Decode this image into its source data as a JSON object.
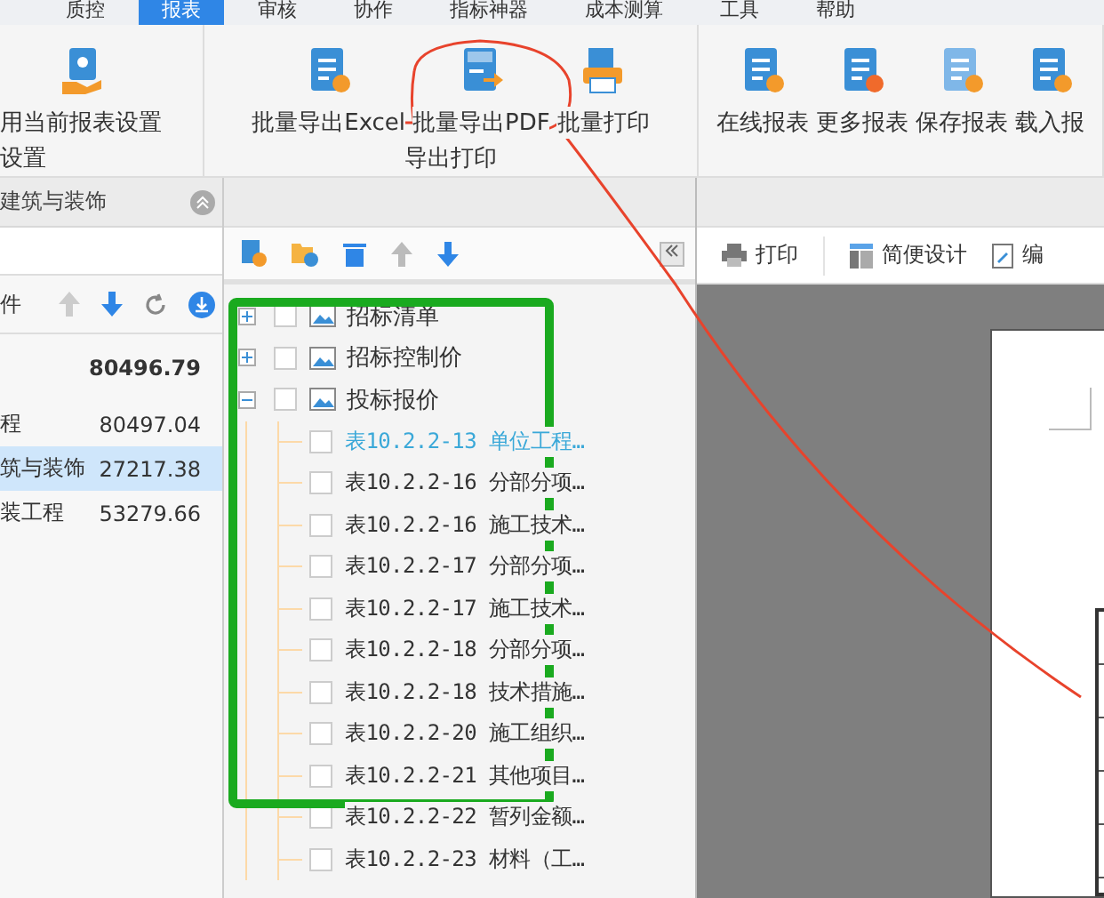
{
  "menu": [
    {
      "label": "质控",
      "selected": false
    },
    {
      "label": "报表",
      "selected": true
    },
    {
      "label": "审核",
      "selected": false
    },
    {
      "label": "协作",
      "selected": false
    },
    {
      "label": "指标神器",
      "selected": false
    },
    {
      "label": "成本测算",
      "selected": false
    },
    {
      "label": "工具",
      "selected": false
    },
    {
      "label": "帮助",
      "selected": false
    }
  ],
  "ribbon": {
    "groups": [
      {
        "label": "设置",
        "buttons": [
          {
            "label": "用当前报表设置"
          }
        ]
      },
      {
        "label": "导出打印",
        "buttons": [
          {
            "label": "批量导出Excel"
          },
          {
            "label": "批量导出PDF"
          },
          {
            "label": "批量打印"
          }
        ]
      },
      {
        "buttons": [
          {
            "label": "在线报表"
          },
          {
            "label": "更多报表"
          },
          {
            "label": "保存报表"
          },
          {
            "label": "载入报"
          }
        ]
      }
    ]
  },
  "project_panel": {
    "title": "建筑与装饰",
    "header_label": "件",
    "rows": [
      {
        "kind": "total",
        "value": "80496.79",
        "selected": false
      },
      {
        "kind": "item",
        "label": "程",
        "value": "80497.04",
        "selected": false
      },
      {
        "kind": "item",
        "label": "筑与装饰",
        "value": "27217.38",
        "selected": true
      },
      {
        "kind": "item",
        "label": "装工程",
        "value": "53279.66",
        "selected": false
      }
    ]
  },
  "report_tree": [
    {
      "label": "招标清单",
      "expanded": false,
      "checked": false
    },
    {
      "label": "招标控制价",
      "expanded": false,
      "checked": false
    },
    {
      "label": "投标报价",
      "expanded": true,
      "checked": false,
      "children": [
        {
          "label": "表10.2.2-13 单位工程…",
          "selected": true,
          "checked": false
        },
        {
          "label": "表10.2.2-16 分部分项…",
          "selected": false,
          "checked": false
        },
        {
          "label": "表10.2.2-16 施工技术…",
          "selected": false,
          "checked": false
        },
        {
          "label": "表10.2.2-17 分部分项…",
          "selected": false,
          "checked": false
        },
        {
          "label": "表10.2.2-17 施工技术…",
          "selected": false,
          "checked": false
        },
        {
          "label": "表10.2.2-18 分部分项…",
          "selected": false,
          "checked": false
        },
        {
          "label": "表10.2.2-18 技术措施…",
          "selected": false,
          "checked": false
        },
        {
          "label": "表10.2.2-20 施工组织…",
          "selected": false,
          "checked": false
        },
        {
          "label": "表10.2.2-21 其他项目…",
          "selected": false,
          "checked": false
        },
        {
          "label": "表10.2.2-22 暂列金额…",
          "selected": false,
          "checked": false
        },
        {
          "label": "表10.2.2-23 材料（工…",
          "selected": false,
          "checked": false
        }
      ]
    }
  ],
  "preview_toolbar": [
    "打印",
    "简便设计",
    "编"
  ]
}
